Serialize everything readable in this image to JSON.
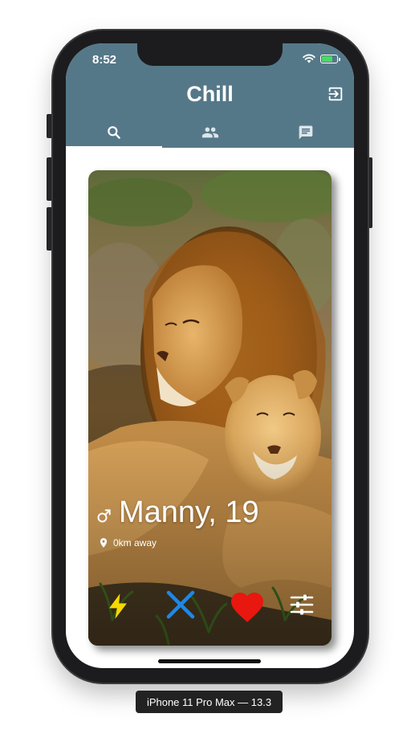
{
  "status_bar": {
    "time": "8:52",
    "battery_level": 0.75
  },
  "header": {
    "title": "Chill"
  },
  "tabs": [
    {
      "icon": "search-icon",
      "active": true
    },
    {
      "icon": "people-icon",
      "active": false
    },
    {
      "icon": "chat-icon",
      "active": false
    }
  ],
  "profile": {
    "name_age": "Manny, 19",
    "gender_icon": "male-symbol-icon",
    "distance": "0km away"
  },
  "actions": [
    {
      "icon": "lightning-bolt-icon",
      "color": "#f5d800"
    },
    {
      "icon": "close-x-icon",
      "color": "#1e88e5"
    },
    {
      "icon": "heart-icon",
      "color": "#e8170f"
    },
    {
      "icon": "sliders-icon",
      "color": "#ffffff"
    }
  ],
  "colors": {
    "app_bar": "#557889"
  },
  "simulator_label": "iPhone 11 Pro Max — 13.3"
}
